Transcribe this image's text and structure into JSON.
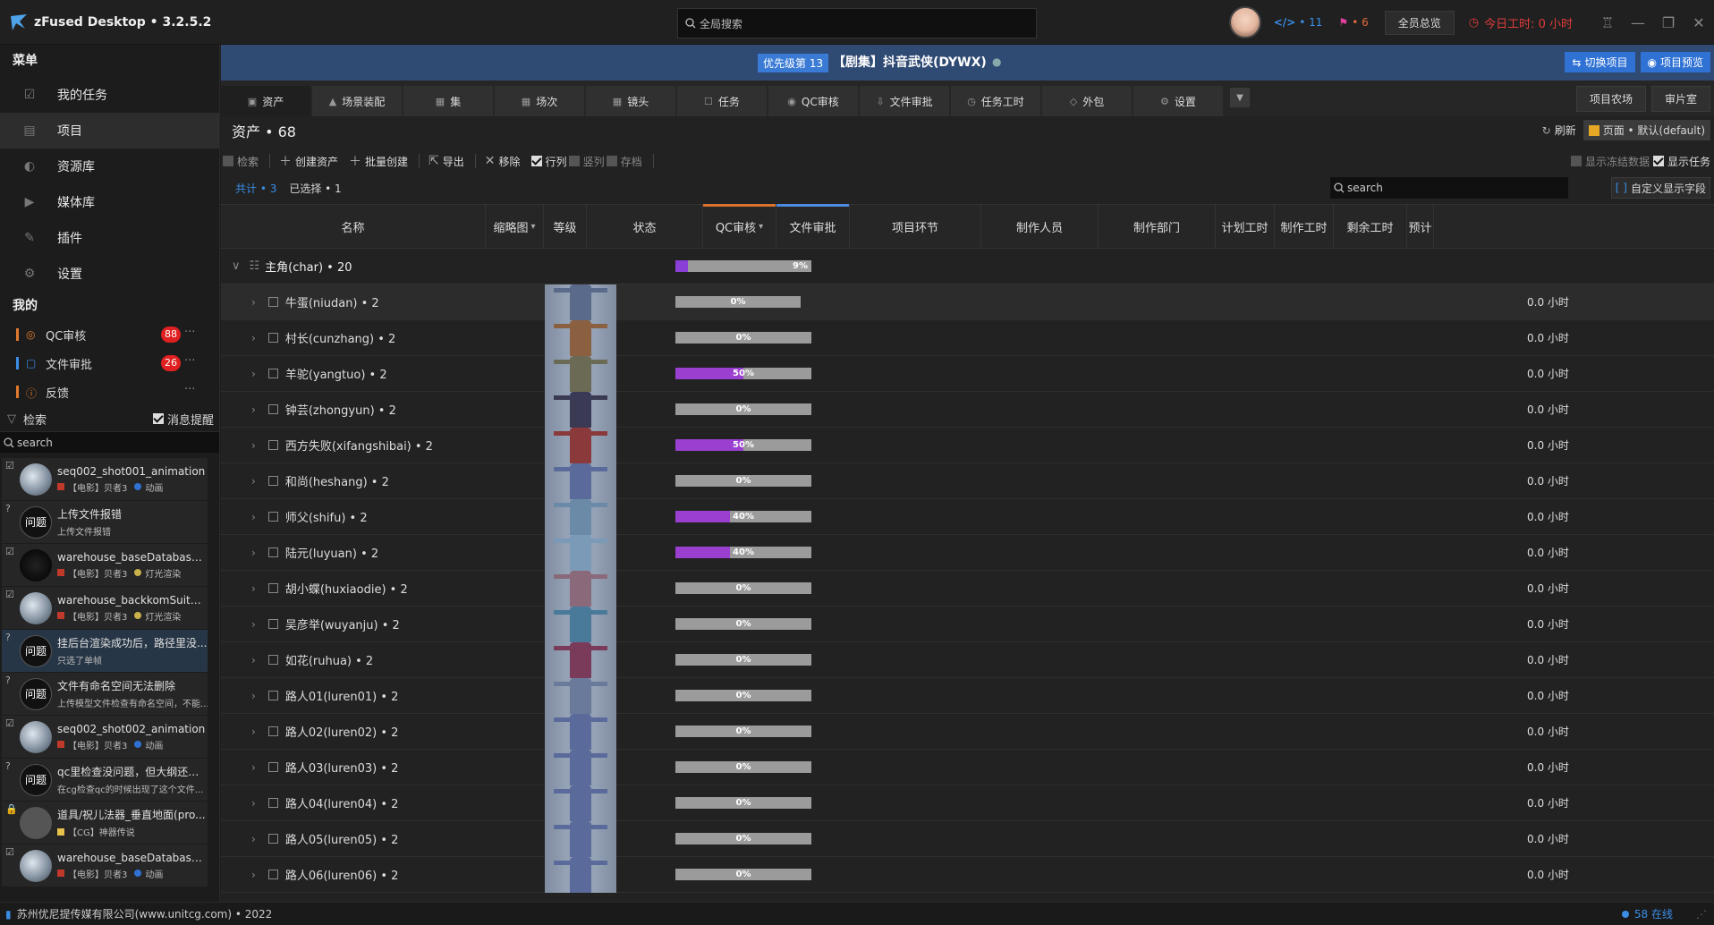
{
  "app": {
    "title": "zFused Desktop • 3.2.5.2"
  },
  "topbar": {
    "search_placeholder": "全局搜索",
    "code_count": "• 11",
    "task_count": "• 6",
    "overview_btn": "全员总览",
    "worktime": "今日工时: 0 小时",
    "colors": {
      "code": "#3a8ee6",
      "task": "#e0409c",
      "worktime": "#e23b3b"
    }
  },
  "sidebar": {
    "menu_header": "菜单",
    "items": [
      {
        "label": "我的任务",
        "icon": "checkbox-icon"
      },
      {
        "label": "项目",
        "icon": "project-icon",
        "active": true
      },
      {
        "label": "资源库",
        "icon": "library-icon"
      },
      {
        "label": "媒体库",
        "icon": "media-icon"
      },
      {
        "label": "插件",
        "icon": "plugin-icon"
      },
      {
        "label": "设置",
        "icon": "gear-icon"
      }
    ],
    "mine_header": "我的",
    "mine": [
      {
        "label": "QC审核",
        "badge": "88",
        "bar": "#e07a2e"
      },
      {
        "label": "文件审批",
        "badge": "26",
        "bar": "#3a8ee6"
      },
      {
        "label": "反馈",
        "badge": "",
        "bar": "#e07a2e"
      }
    ],
    "filter_label": "检索",
    "notify_label": "消息提醒",
    "search_placeholder": "search",
    "messages": [
      {
        "title": "seq002_shot001_animation",
        "sub1": "【电影】贝者3",
        "sub2": "动画",
        "kind": "img",
        "dot": "#2f72d4"
      },
      {
        "title": "上传文件报错",
        "sub1": "上传文件报错",
        "sub2": "",
        "kind": "q",
        "thumb": "问题"
      },
      {
        "title": "warehouse_baseDatabase_ac",
        "sub1": "【电影】贝者3",
        "sub2": "灯光渲染",
        "kind": "dark",
        "dot": "#c8b04a"
      },
      {
        "title": "warehouse_backkomSuitMuc",
        "sub1": "【电影】贝者3",
        "sub2": "灯光渲染",
        "kind": "img",
        "dot": "#c8b04a"
      },
      {
        "title": "挂后台渲染成功后，路径里没...",
        "sub1": "只选了单帧",
        "sub2": "",
        "kind": "q",
        "thumb": "问题",
        "selected": true
      },
      {
        "title": "文件有命名空间无法删除",
        "sub1": "上传模型文件检查有命名空间，不能...",
        "sub2": "",
        "kind": "q",
        "thumb": "问题"
      },
      {
        "title": "seq002_shot002_animation",
        "sub1": "【电影】贝者3",
        "sub2": "动画",
        "kind": "img",
        "dot": "#2f72d4"
      },
      {
        "title": "qc里检查没问题，但大纲还是...",
        "sub1": "在cg检查qc的时候出现了这个文件...",
        "sub2": "",
        "kind": "q",
        "thumb": "问题"
      },
      {
        "title": "道具/祝儿法器_垂直地面(pro...",
        "sub1": "【CG】神器传说",
        "sub2": "",
        "kind": "gray",
        "sq": "#e6c24a"
      },
      {
        "title": "warehouse_baseDatabase_ac",
        "sub1": "【电影】贝者3",
        "sub2": "动画",
        "kind": "img",
        "dot": "#2f72d4"
      }
    ]
  },
  "project": {
    "priority": "优先级第 13",
    "name": "【剧集】抖音武侠(DYWX)",
    "switch_btn": "切换项目",
    "preview_btn": "项目预览"
  },
  "tabs": [
    {
      "label": "资产",
      "active": true
    },
    {
      "label": "场景装配"
    },
    {
      "label": "集"
    },
    {
      "label": "场次"
    },
    {
      "label": "镜头"
    },
    {
      "label": "任务"
    },
    {
      "label": "QC审核"
    },
    {
      "label": "文件审批"
    },
    {
      "label": "任务工时"
    },
    {
      "label": "外包"
    },
    {
      "label": "设置"
    }
  ],
  "side_btns": {
    "farm": "项目农场",
    "review": "审片室"
  },
  "section": {
    "title": "资产 • 68",
    "refresh": "刷新",
    "page": "页面 • 默认(default)",
    "toolbar": {
      "search": "检索",
      "create": "创建资产",
      "batch": "批量创建",
      "export": "导出",
      "remove": "移除",
      "row": "行列",
      "col": "竖列",
      "store": "存档"
    },
    "show_frozen": "显示冻结数据",
    "show_task": "显示任务",
    "total": "共计 • 3",
    "selected": "已选择 • 1",
    "search_placeholder": "search",
    "custom_field": "自定义显示字段"
  },
  "columns": [
    "名称",
    "缩略图",
    "等级",
    "状态",
    "QC审核",
    "文件审批",
    "项目环节",
    "制作人员",
    "制作部门",
    "计划工时",
    "制作工时",
    "剩余工时",
    "预计"
  ],
  "group": {
    "label": "主角(char) • 20",
    "progress": 9
  },
  "rows": [
    {
      "name": "牛蛋(niudan) • 2",
      "progress": 0,
      "hours": "0.0 小时"
    },
    {
      "name": "村长(cunzhang) • 2",
      "progress": 0,
      "hours": "0.0 小时"
    },
    {
      "name": "羊驼(yangtuo) • 2",
      "progress": 50,
      "hours": "0.0 小时"
    },
    {
      "name": "钟芸(zhongyun) • 2",
      "progress": 0,
      "hours": "0.0 小时"
    },
    {
      "name": "西方失败(xifangshibai) • 2",
      "progress": 50,
      "hours": "0.0 小时"
    },
    {
      "name": "和尚(heshang) • 2",
      "progress": 0,
      "hours": "0.0 小时"
    },
    {
      "name": "师父(shifu) • 2",
      "progress": 40,
      "hours": "0.0 小时"
    },
    {
      "name": "陆元(luyuan) • 2",
      "progress": 40,
      "hours": "0.0 小时"
    },
    {
      "name": "胡小蝶(huxiaodie) • 2",
      "progress": 0,
      "hours": "0.0 小时"
    },
    {
      "name": "吴彦举(wuyanju) • 2",
      "progress": 0,
      "hours": "0.0 小时"
    },
    {
      "name": "如花(ruhua) • 2",
      "progress": 0,
      "hours": "0.0 小时"
    },
    {
      "name": "路人01(luren01) • 2",
      "progress": 0,
      "hours": "0.0 小时"
    },
    {
      "name": "路人02(luren02) • 2",
      "progress": 0,
      "hours": "0.0 小时"
    },
    {
      "name": "路人03(luren03) • 2",
      "progress": 0,
      "hours": "0.0 小时"
    },
    {
      "name": "路人04(luren04) • 2",
      "progress": 0,
      "hours": "0.0 小时"
    },
    {
      "name": "路人05(luren05) • 2",
      "progress": 0,
      "hours": "0.0 小时"
    },
    {
      "name": "路人06(luren06) • 2",
      "progress": 0,
      "hours": "0.0 小时"
    }
  ],
  "footer": {
    "company": "苏州优尼提传媒有限公司(www.unitcg.com) • 2022",
    "online": "58 在线"
  }
}
